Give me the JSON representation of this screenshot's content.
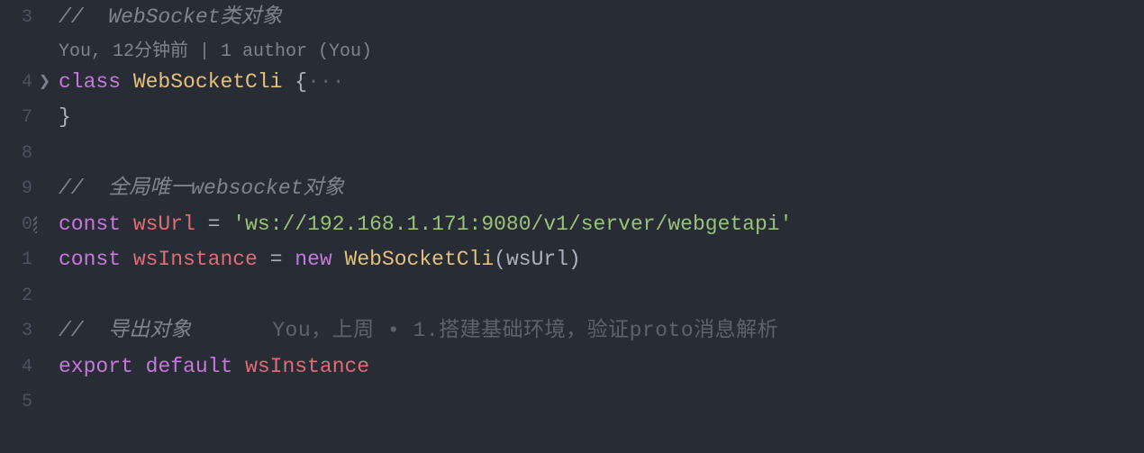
{
  "gutter": {
    "lines": [
      "3",
      "4",
      "7",
      "8",
      "9",
      "0",
      "1",
      "2",
      "3",
      "4",
      "5"
    ]
  },
  "code": {
    "l3_comment": "//  WebSocket类对象",
    "lens1": "You, 12分钟前 | 1 author (You)",
    "l4_class_kw": "class",
    "l4_class_name": "WebSocketCli",
    "l4_brace_open": "{",
    "l4_dots": "···",
    "l7_brace_close": "}",
    "l9_comment": "//  全局唯一websocket对象",
    "l10_const": "const",
    "l10_ident": "wsUrl",
    "l10_eq": "=",
    "l10_str": "'ws://192.168.1.171:9080/v1/server/webgetapi'",
    "l11_const": "const",
    "l11_ident": "wsInstance",
    "l11_eq": "=",
    "l11_new": "new",
    "l11_ctor": "WebSocketCli",
    "l11_lpar": "(",
    "l11_arg": "wsUrl",
    "l11_rpar": ")",
    "l13_comment": "//  导出对象",
    "lens2": "You，上周 • 1.搭建基础环境，验证proto消息解析",
    "l14_export": "export",
    "l14_default": "default",
    "l14_ident": "wsInstance"
  }
}
